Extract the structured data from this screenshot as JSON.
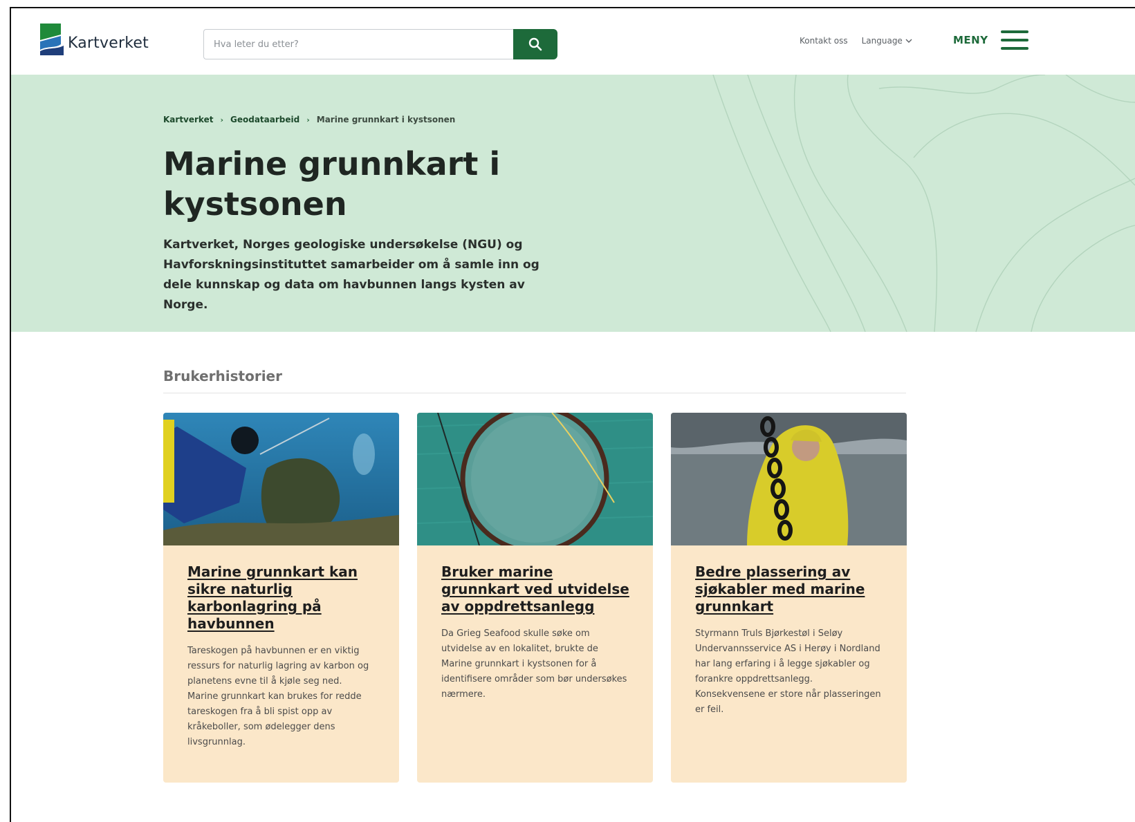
{
  "header": {
    "logo_text": "Kartverket",
    "search_placeholder": "Hva leter du etter?",
    "top_links": [
      "Kontakt oss",
      "Language"
    ],
    "menu_label": "MENY"
  },
  "breadcrumb": [
    "Kartverket",
    "Geodataarbeid",
    "Marine grunnkart i kystsonen"
  ],
  "hero": {
    "title": "Marine grunnkart i kystsonen",
    "lead": "Kartverket, Norges geologiske undersøkelse (NGU) og Havforskningsinstituttet samarbeider om å samle inn og dele kunnskap og data om havbunnen langs kysten av Norge."
  },
  "section": {
    "title": "Brukerhistorier"
  },
  "cards": [
    {
      "title": "Marine grunnkart kan sikre naturlig karbonlagring på havbunnen",
      "text": "Tareskogen på havbunnen er en viktig ressurs for naturlig lagring av karbon og planetens evne til å kjøle seg ned. Marine grunnkart kan brukes for redde tareskogen fra å bli spist opp av kråkeboller, som ødelegger dens livsgrunnlag."
    },
    {
      "title": "Bruker marine grunnkart ved utvidelse av oppdrettsanlegg",
      "text": "Da Grieg Seafood skulle søke om utvidelse av en lokalitet, brukte de Marine grunnkart i kystsonen for å identifisere områder som bør undersøkes nærmere."
    },
    {
      "title": "Bedre plassering av sjøkabler med marine grunnkart",
      "text": "Styrmann Truls Bjørkestøl i Seløy Undervannsservice AS i Herøy i Nordland har lang erfaring i å legge sjøkabler og forankre oppdrettsanlegg. Konsekvensene er store når plasseringen er feil."
    }
  ],
  "colors": {
    "brand_green": "#1d6a3a",
    "hero_bg": "#cfe9d6",
    "card_bg": "#fbe7c9"
  }
}
